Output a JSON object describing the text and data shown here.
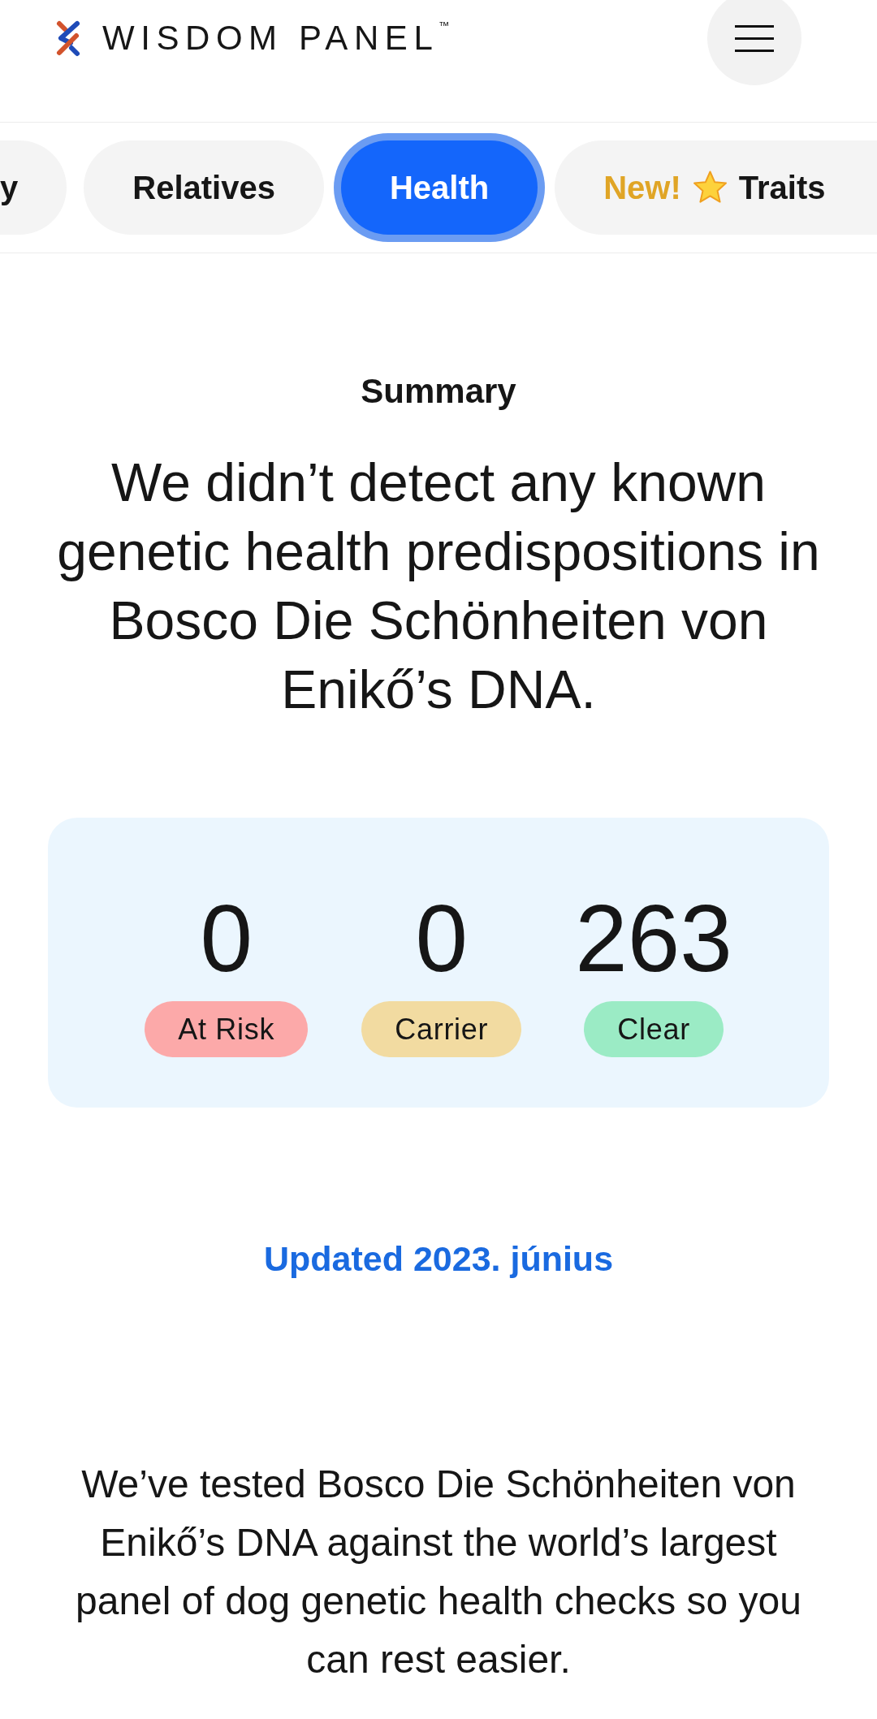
{
  "header": {
    "logo": "WISDOM PANEL$^{™}$"
  },
  "tabs": [
    {
      "label": "y",
      "selected": false
    },
    {
      "label": "Relatives",
      "selected": false
    },
    {
      "label": "Health",
      "selected": true
    },
    {
      "tag": "New!",
      "label": "Traits",
      "selected": false
    }
  ],
  "summary": {
    "heading": "Summary",
    "headline": "We didn’t detect any known genetic health predispositions in Bosco Die Schönheiten von Enikő’s DNA."
  },
  "results": [
    {
      "count": "0",
      "label": "At Risk",
      "color": "#fca9a9"
    },
    {
      "count": "0",
      "label": "Carrier",
      "color": "#f2dba1"
    },
    {
      "count": "263",
      "label": "Clear",
      "color": "#9bebc5"
    }
  ],
  "updated": "Updated 2023. június",
  "intro": "We’ve tested Bosco Die Schönheiten von Enikő’s DNA against the world’s largest panel of dog genetic health checks so you can rest easier."
}
